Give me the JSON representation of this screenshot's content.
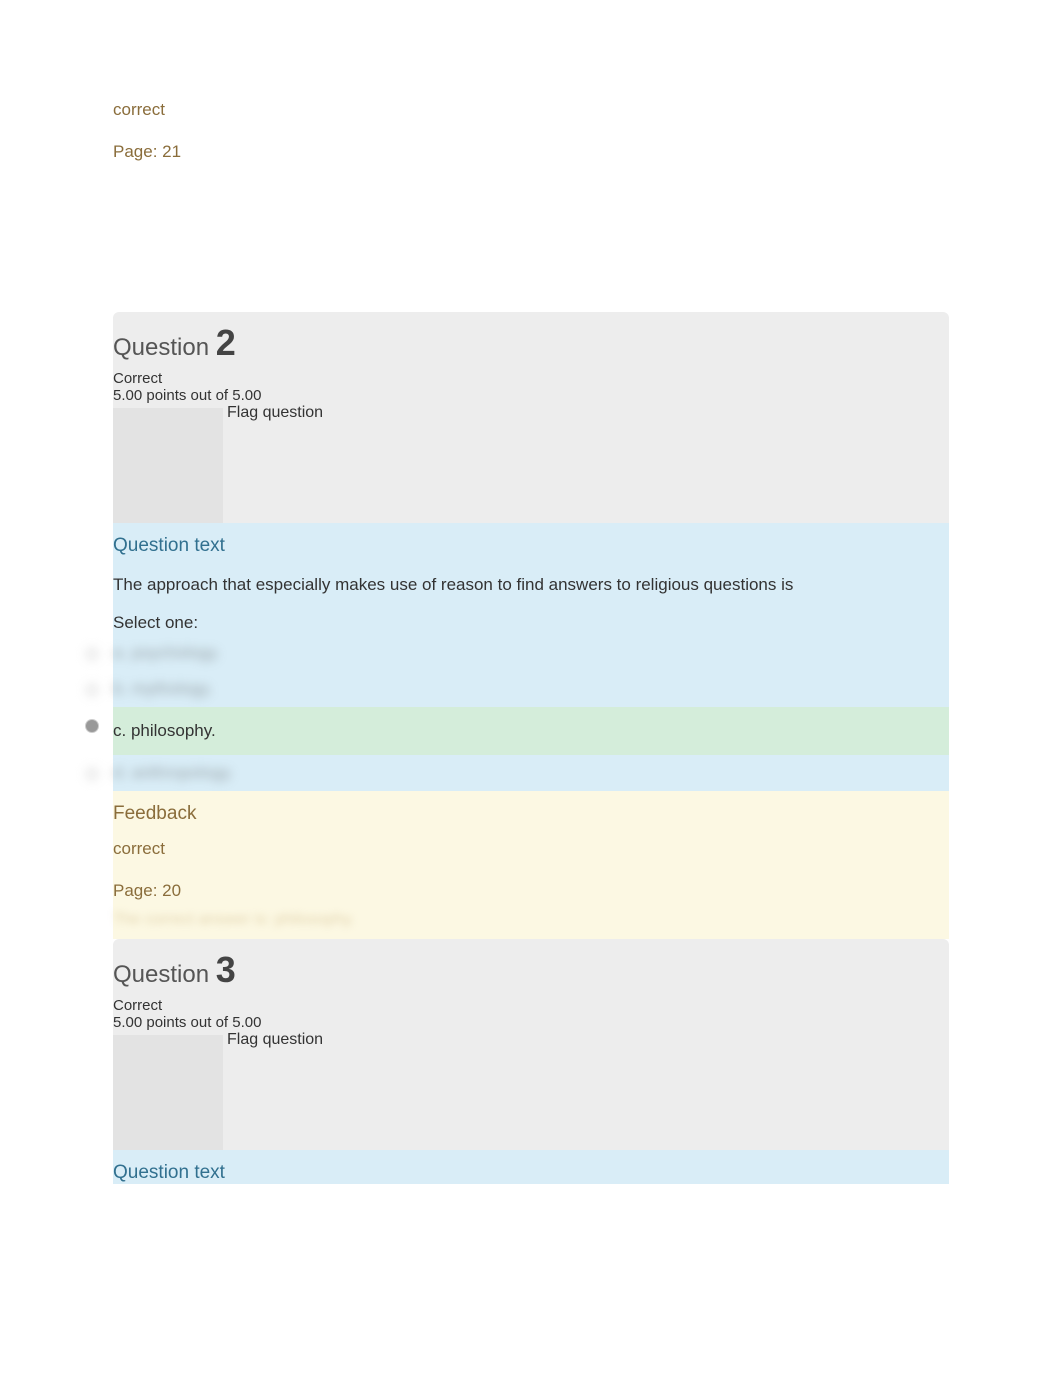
{
  "feedback_top": {
    "correct": "correct",
    "page": "Page: 21"
  },
  "q2": {
    "title_prefix": "Question ",
    "number": "2",
    "status": "Correct",
    "points": "5.00 points out of 5.00",
    "flag": "Flag question",
    "qtext_heading": "Question text",
    "prompt": "The approach that especially makes use of reason to find answers to religious questions is",
    "select_one": "Select one:",
    "options": {
      "a": "a. psychology.",
      "b": "b. mythology.",
      "c": "c. philosophy.",
      "d": "d. anthropology."
    },
    "feedback_heading": "Feedback",
    "feedback_correct": "correct",
    "feedback_page": "Page: 20",
    "correct_answer": "The correct answer is: philosophy."
  },
  "q3": {
    "title_prefix": "Question ",
    "number": "3",
    "status": "Correct",
    "points": "5.00 points out of 5.00",
    "flag": "Flag question",
    "qtext_heading": "Question text"
  }
}
